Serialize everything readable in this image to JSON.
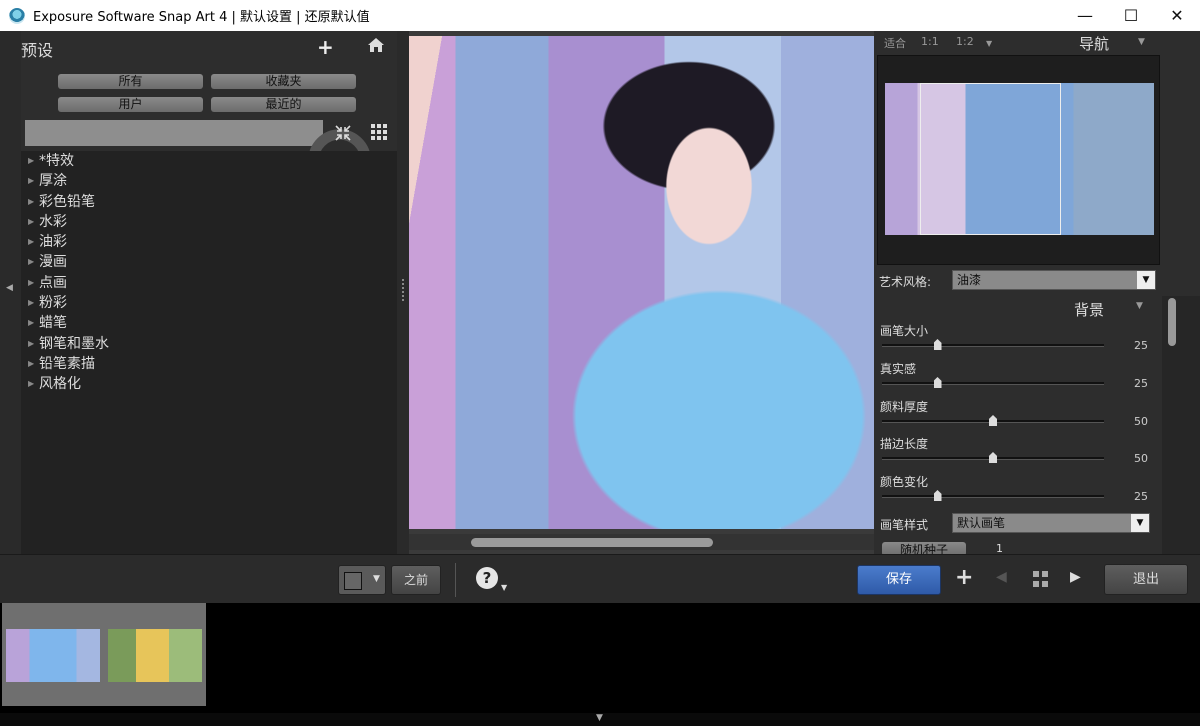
{
  "window": {
    "title": "Exposure Software Snap Art 4 | 默认设置 | 还原默认值",
    "minimize": "—",
    "maximize": "☐",
    "close": "✕"
  },
  "presets": {
    "title": "预设",
    "filters": [
      "所有",
      "收藏夹",
      "用户",
      "最近的"
    ],
    "search_value": "",
    "categories": [
      "*特效",
      "厚涂",
      "彩色铅笔",
      "水彩",
      "油彩",
      "漫画",
      "点画",
      "粉彩",
      "蜡笔",
      "钢笔和墨水",
      "铅笔素描",
      "风格化"
    ]
  },
  "navigator": {
    "zoom_fit": "适合",
    "zoom_1_1": "1:1",
    "zoom_1_2": "1:2",
    "title": "导航"
  },
  "settings": {
    "art_style_label": "艺术风格:",
    "art_style_value": "油漆",
    "section_title": "背景",
    "sliders": [
      {
        "label": "画笔大小",
        "value": 25,
        "display": "25"
      },
      {
        "label": "真实感",
        "value": 25,
        "display": "25"
      },
      {
        "label": "颜料厚度",
        "value": 50,
        "display": "50"
      },
      {
        "label": "描边长度",
        "value": 50,
        "display": "50"
      },
      {
        "label": "颜色变化",
        "value": 25,
        "display": "25"
      }
    ],
    "brush_style_label": "画笔样式",
    "brush_style_value": "默认画笔",
    "random_seed_label": "随机种子",
    "random_seed_value": "1"
  },
  "toolbar": {
    "before_label": "之前",
    "help_label": "?",
    "save_label": "保存",
    "exit_label": "退出"
  },
  "colors": {
    "accent": "#3f6dbf"
  }
}
